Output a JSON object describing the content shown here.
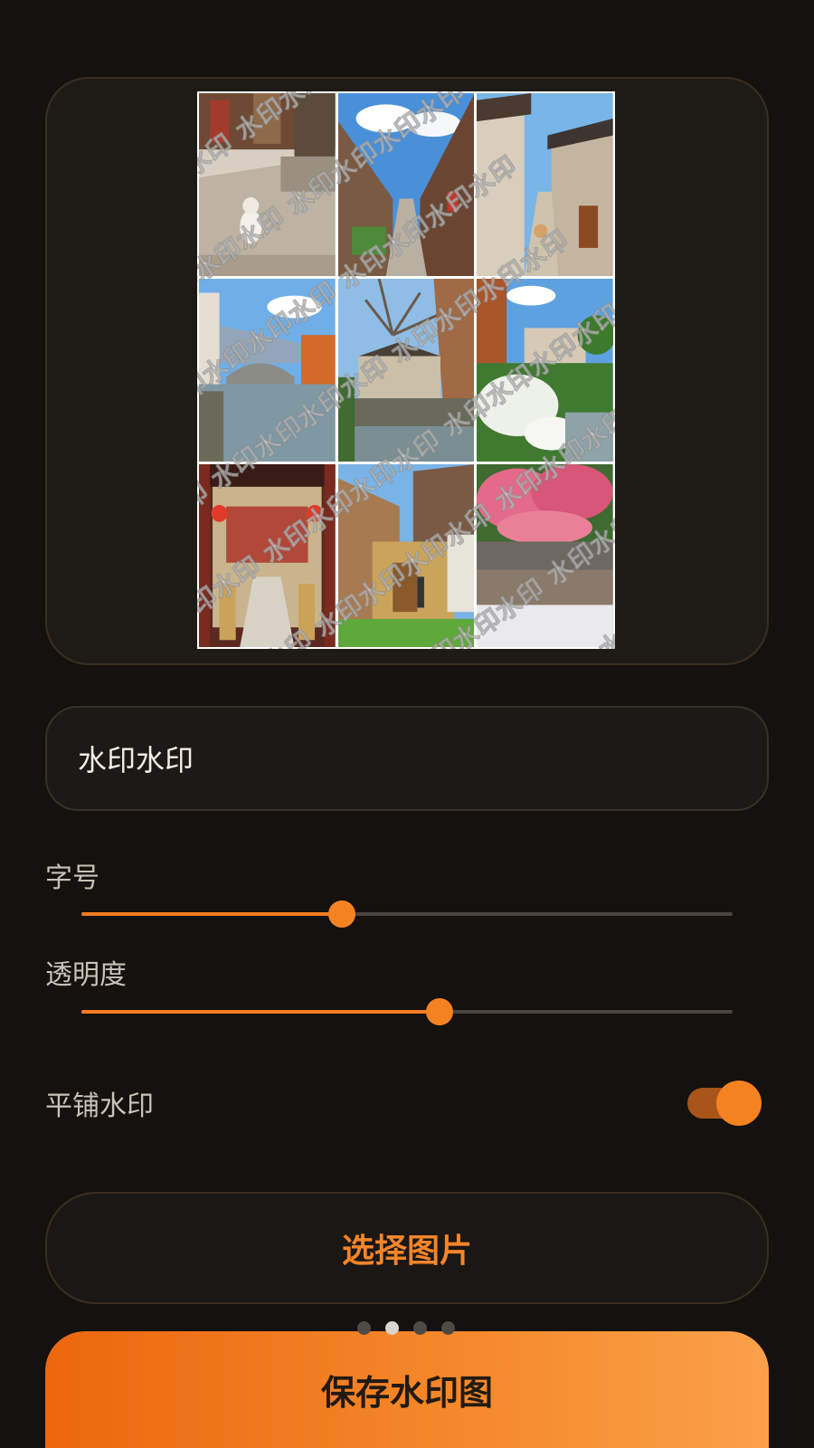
{
  "preview": {
    "watermark_text": "水印水印",
    "photos": [
      "cat-alley",
      "street-blue-sky",
      "old-lane",
      "stone-bridge-canal",
      "canal-tree",
      "white-flowers-canal",
      "red-gate-courtyard",
      "yellow-door-shop",
      "pink-blossom-wall"
    ]
  },
  "watermark_input": {
    "value": "水印水印"
  },
  "font_size": {
    "label": "字号",
    "value": 0.4
  },
  "opacity": {
    "label": "透明度",
    "value": 0.55
  },
  "tile": {
    "label": "平铺水印",
    "enabled": true
  },
  "actions": {
    "select_label": "选择图片",
    "save_label": "保存水印图"
  },
  "pager": {
    "count": 4,
    "active": 1
  },
  "colors": {
    "accent": "#f58220",
    "background": "#14110e"
  }
}
